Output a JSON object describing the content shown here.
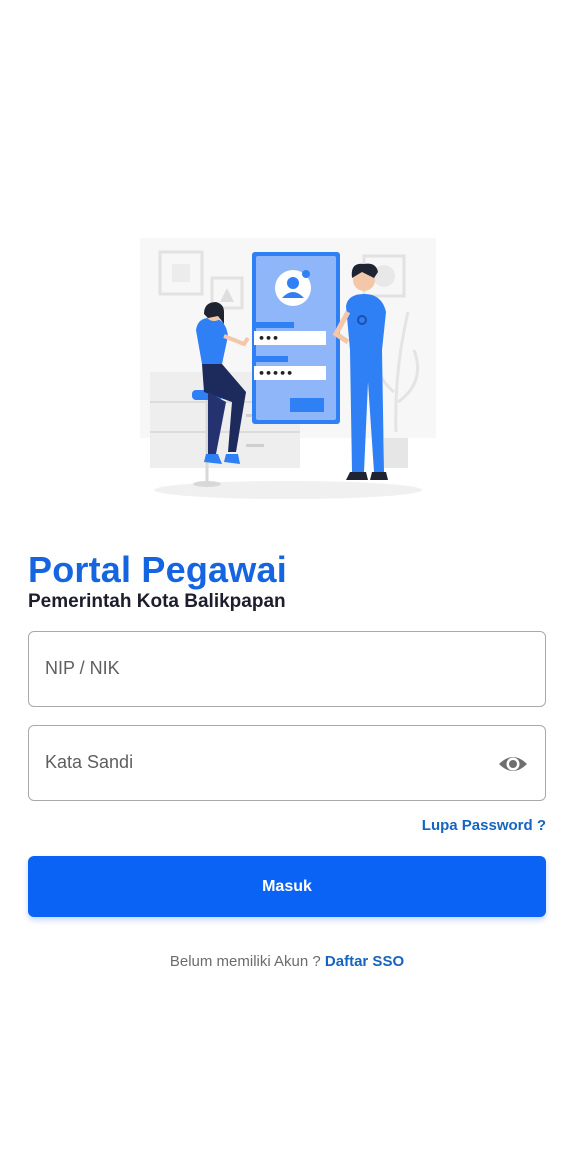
{
  "header": {
    "title": "Portal Pegawai",
    "subtitle": "Pemerintah Kota Balikpapan"
  },
  "form": {
    "nip_field": {
      "placeholder": "NIP / NIK",
      "value": ""
    },
    "password_field": {
      "placeholder": "Kata Sandi",
      "value": "",
      "toggle_icon": "eye-icon"
    },
    "forgot_label": "Lupa Password ?",
    "login_label": "Masuk"
  },
  "footer": {
    "prompt": "Belum memiliki Akun ?",
    "register_link": "Daftar SSO"
  },
  "colors": {
    "primary": "#0b63f6",
    "title": "#1565e0",
    "link": "#1565c0",
    "subtitle": "#1d1d2b"
  },
  "illustration": {
    "icon": "login-illustration",
    "pin_dots": "•••",
    "password_dots": "•••••"
  }
}
